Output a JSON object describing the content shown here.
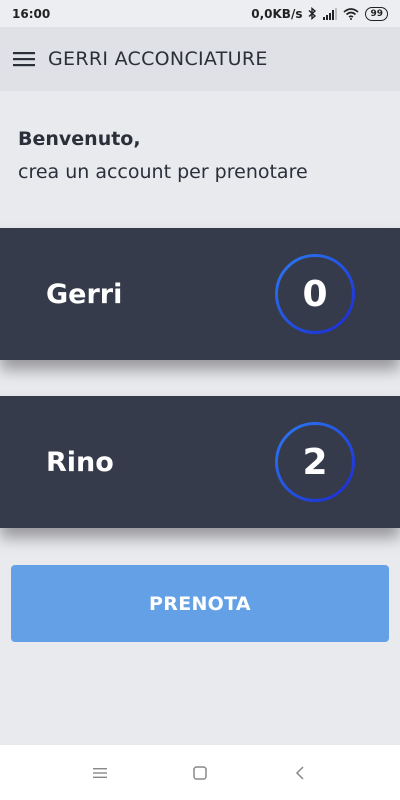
{
  "status_bar": {
    "time": "16:00",
    "network_speed": "0,0KB/s",
    "battery": "99",
    "icons": [
      "bluetooth-icon",
      "signal-icon",
      "wifi-icon",
      "battery-icon"
    ]
  },
  "app_bar": {
    "title": "GERRI ACCONCIATURE",
    "menu_icon": "hamburger-menu-icon"
  },
  "welcome": {
    "title": "Benvenuto,",
    "subtitle": "crea un account per prenotare"
  },
  "barbers": [
    {
      "name": "Gerri",
      "count": "0"
    },
    {
      "name": "Rino",
      "count": "2"
    }
  ],
  "book_button": {
    "label": "PRENOTA",
    "color": "#64a0e6"
  },
  "nav_bar": {
    "icons": [
      "recent-apps-icon",
      "home-icon",
      "back-icon"
    ]
  },
  "colors": {
    "card_bg": "#353b4a",
    "ring_gradient_start": "#2d6ff0",
    "ring_gradient_end": "#1b2fd0",
    "background": "#e9eaee"
  }
}
